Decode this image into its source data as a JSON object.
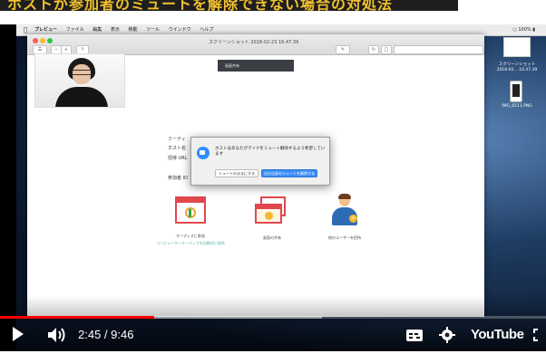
{
  "banner": {
    "title": "ホストが参加者のミュートを解除できない場合の対処法"
  },
  "mac_menubar": {
    "items": [
      "プレビュー",
      "ファイル",
      "編集",
      "表示",
      "移動",
      "ツール",
      "ウインドウ",
      "ヘルプ"
    ],
    "status": "100%"
  },
  "preview_window": {
    "title": "スクリーンショット 2018-02-23 16.47.39"
  },
  "tooltip": {
    "text": "画面共有"
  },
  "zoom_background": {
    "meeting_label": "ミーティ",
    "host_label": "ホスト名",
    "invite_label": "招待 URL",
    "participants_label": "参加者 ID",
    "audio_label": "オーディオに参加",
    "audio_sublabel": "コンピューターオーディオを自動的に接続",
    "share_label": "画面の共有",
    "invite_others_label": "他のユーザーを招待"
  },
  "dialog": {
    "message": "ホストはあなたがマイクをミュート解除するよう希望しています",
    "stay_muted_button": "ミュートのままにする",
    "unmute_button": "自分自身のミュートを解除する"
  },
  "desktop": {
    "screenshot_label": "スクリーンショット 2018-02... 16.47.39",
    "phone_file_label": "IMG_6511.PNG"
  },
  "player": {
    "current_time": "2:45",
    "duration": "9:46",
    "time_display": "2:45 / 9:46",
    "played_fraction": 0.2816,
    "buffered_fraction": 0.59,
    "logo_text": "YouTube",
    "progress_color": "#ff0000"
  }
}
